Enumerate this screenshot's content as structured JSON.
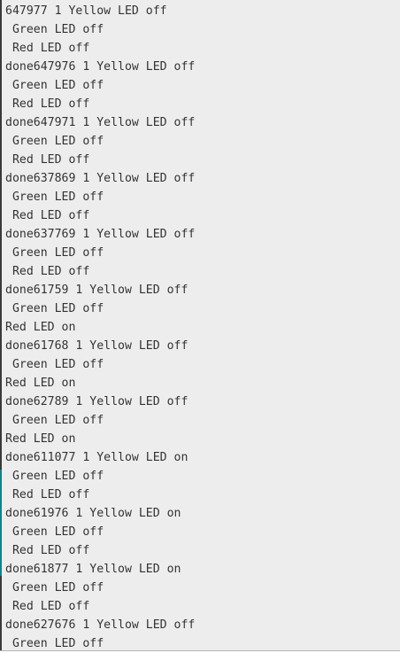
{
  "serial_monitor": {
    "lines": [
      "647977 1 Yellow LED off",
      " Green LED off",
      " Red LED off",
      "done647976 1 Yellow LED off",
      " Green LED off",
      " Red LED off",
      "done647971 1 Yellow LED off",
      " Green LED off",
      " Red LED off",
      "done637869 1 Yellow LED off",
      " Green LED off",
      " Red LED off",
      "done637769 1 Yellow LED off",
      " Green LED off",
      " Red LED off",
      "done61759 1 Yellow LED off",
      " Green LED off",
      "Red LED on",
      "done61768 1 Yellow LED off",
      " Green LED off",
      "Red LED on",
      "done62789 1 Yellow LED off",
      " Green LED off",
      "Red LED on",
      "done611077 1 Yellow LED on",
      " Green LED off",
      " Red LED off",
      "done61976 1 Yellow LED on",
      " Green LED off",
      " Red LED off",
      "done61877 1 Yellow LED on",
      " Green LED off",
      " Red LED off",
      "done627676 1 Yellow LED off",
      " Green LED off"
    ]
  }
}
